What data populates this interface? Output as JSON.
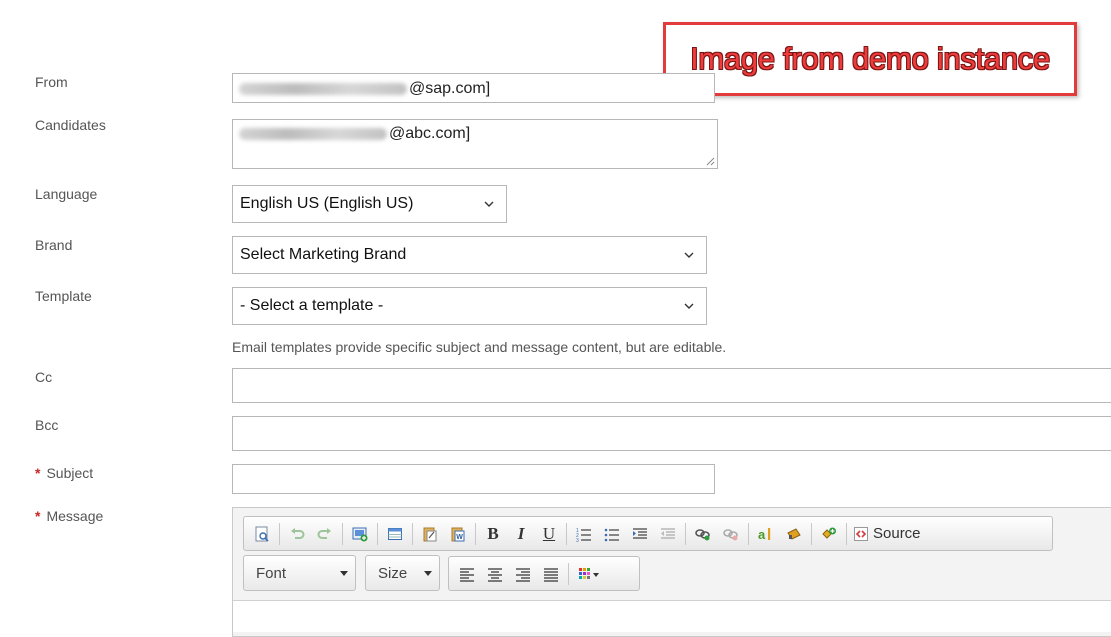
{
  "banner": {
    "text": "Image from demo instance"
  },
  "form": {
    "from_label": "From",
    "from_value_suffix": "@sap.com]",
    "candidates_label": "Candidates",
    "candidates_value_suffix": "@abc.com]",
    "language_label": "Language",
    "language_value": "English US (English US)",
    "brand_label": "Brand",
    "brand_value": "Select Marketing Brand",
    "template_label": "Template",
    "template_value": "- Select a template -",
    "template_hint": "Email templates provide specific subject and message content, but are editable.",
    "cc_label": "Cc",
    "cc_value": "",
    "bcc_label": "Bcc",
    "bcc_value": "",
    "required_marker": "*",
    "subject_label": "Subject",
    "subject_value": "",
    "message_label": "Message"
  },
  "editor": {
    "source_label": "Source",
    "font_label": "Font",
    "size_label": "Size",
    "bold_glyph": "B",
    "italic_glyph": "I",
    "underline_glyph": "U"
  },
  "colors": {
    "banner_red": "#ee3b3b",
    "required_red": "#c62828",
    "border_gray": "#b7b7b7"
  }
}
